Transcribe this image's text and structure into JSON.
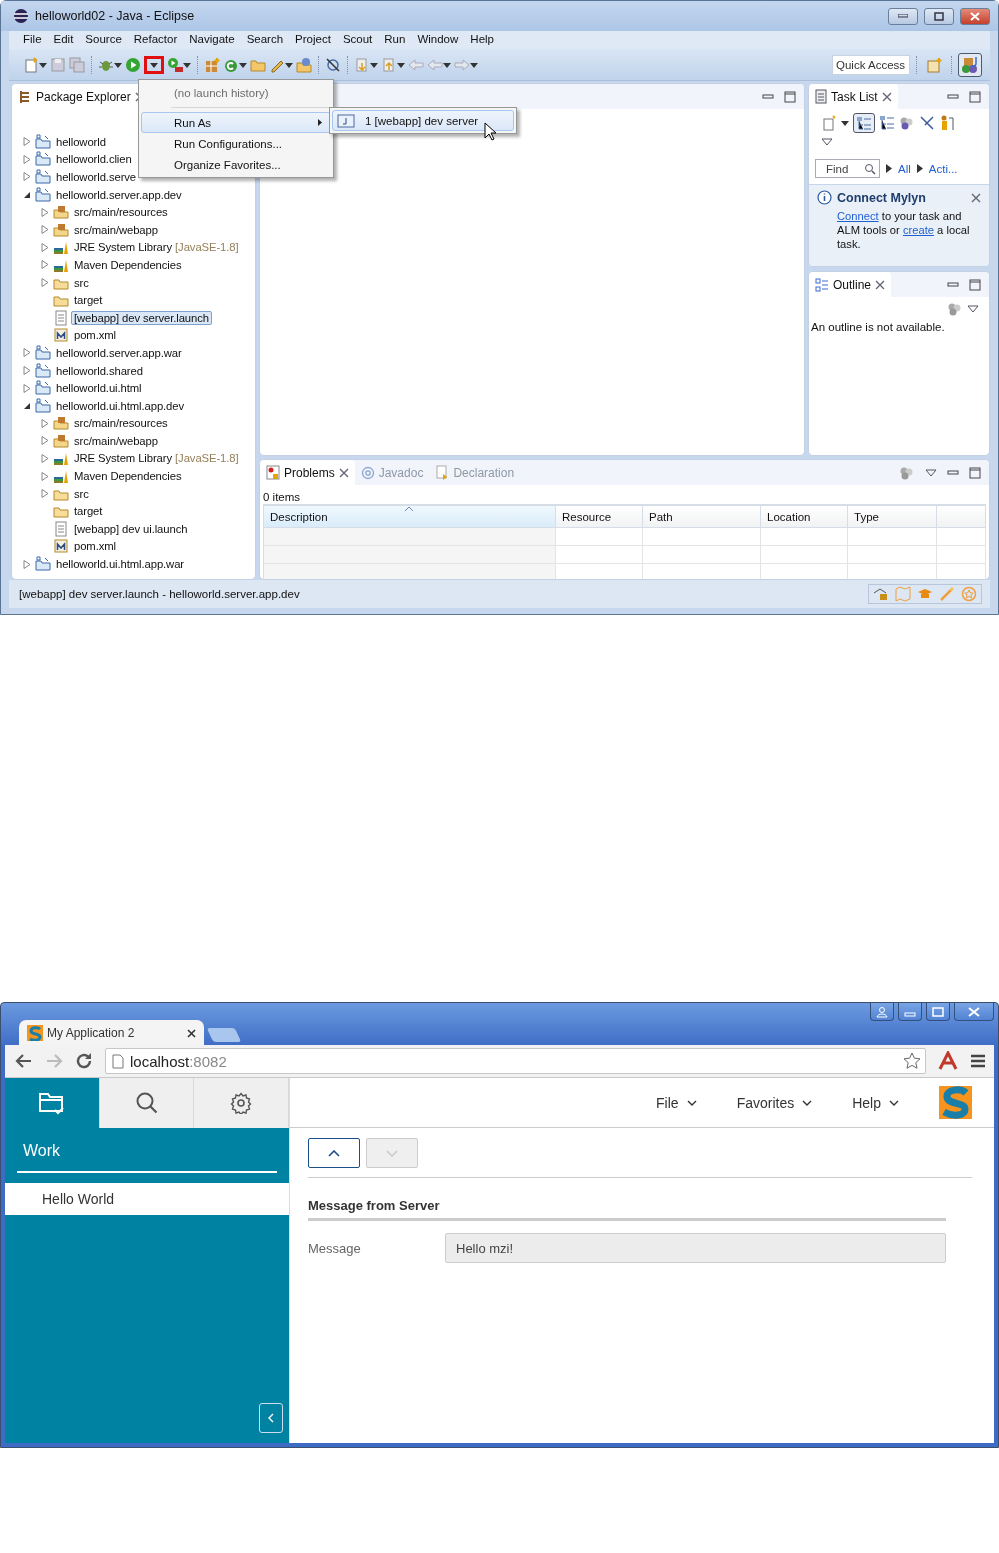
{
  "eclipse": {
    "window": {
      "title": "helloworld02 - Java - Eclipse"
    },
    "menu_bar": [
      "File",
      "Edit",
      "Source",
      "Refactor",
      "Navigate",
      "Search",
      "Project",
      "Scout",
      "Run",
      "Window",
      "Help"
    ],
    "toolbar": {
      "run_dropdown_highlighted": true,
      "quick_access": {
        "placeholder": "Quick Access"
      },
      "java_perspective_selected": true
    },
    "run_menu": {
      "items": [
        {
          "kind": "item",
          "label": "(no launch history)",
          "disabled": true,
          "selected": false,
          "submenu": false
        },
        {
          "kind": "separator"
        },
        {
          "kind": "item",
          "label": "Run As",
          "disabled": false,
          "selected": true,
          "submenu": true
        },
        {
          "kind": "item",
          "label": "Run Configurations...",
          "disabled": false,
          "selected": false,
          "submenu": false
        },
        {
          "kind": "item",
          "label": "Organize Favorites...",
          "disabled": false,
          "selected": false,
          "submenu": false
        }
      ]
    },
    "run_as_submenu": {
      "items": [
        {
          "label": "1 [webapp] dev server",
          "selected": true
        }
      ]
    },
    "package_explorer": {
      "tab": "Package Explorer",
      "tree": [
        {
          "label": "helloworld",
          "kind": "project",
          "expanded": false,
          "selected": false
        },
        {
          "label": "helloworld.clien",
          "kind": "project",
          "expanded": false,
          "selected": false
        },
        {
          "label": "helloworld.serve",
          "kind": "project",
          "expanded": false,
          "selected": false
        },
        {
          "label": "helloworld.server.app.dev",
          "kind": "project",
          "expanded": true,
          "selected": false,
          "children": [
            {
              "label": "src/main/resources",
              "kind": "source-folder",
              "expanded": false,
              "selected": false
            },
            {
              "label": "src/main/webapp",
              "kind": "source-folder",
              "expanded": false,
              "selected": false
            },
            {
              "label": "JRE System Library",
              "decoration": "[JavaSE-1.8]",
              "kind": "library",
              "expanded": false,
              "selected": false
            },
            {
              "label": "Maven Dependencies",
              "kind": "library",
              "expanded": false,
              "selected": false
            },
            {
              "label": "src",
              "kind": "folder",
              "expanded": false,
              "selected": false
            },
            {
              "label": "target",
              "kind": "folder",
              "selected": false
            },
            {
              "label": "[webapp] dev server.launch",
              "kind": "file",
              "selected": true
            },
            {
              "label": "pom.xml",
              "kind": "maven-file",
              "selected": false
            }
          ]
        },
        {
          "label": "helloworld.server.app.war",
          "kind": "project",
          "expanded": false,
          "selected": false
        },
        {
          "label": "helloworld.shared",
          "kind": "project",
          "expanded": false,
          "selected": false
        },
        {
          "label": "helloworld.ui.html",
          "kind": "project",
          "expanded": false,
          "selected": false
        },
        {
          "label": "helloworld.ui.html.app.dev",
          "kind": "project",
          "expanded": true,
          "selected": false,
          "children": [
            {
              "label": "src/main/resources",
              "kind": "source-folder",
              "expanded": false,
              "selected": false
            },
            {
              "label": "src/main/webapp",
              "kind": "source-folder",
              "expanded": false,
              "selected": false
            },
            {
              "label": "JRE System Library",
              "decoration": "[JavaSE-1.8]",
              "kind": "library",
              "expanded": false,
              "selected": false
            },
            {
              "label": "Maven Dependencies",
              "kind": "library",
              "expanded": false,
              "selected": false
            },
            {
              "label": "src",
              "kind": "folder",
              "expanded": false,
              "selected": false
            },
            {
              "label": "target",
              "kind": "folder",
              "selected": false
            },
            {
              "label": "[webapp] dev ui.launch",
              "kind": "file",
              "selected": false
            },
            {
              "label": "pom.xml",
              "kind": "maven-file",
              "selected": false
            }
          ]
        },
        {
          "label": "helloworld.ui.html.app.war",
          "kind": "project",
          "expanded": false,
          "selected": false
        }
      ]
    },
    "task_list": {
      "tab": "Task List",
      "categorized_pressed": true,
      "find": {
        "placeholder": "Find"
      },
      "filters": [
        "All",
        "Acti..."
      ],
      "mylyn": {
        "title": "Connect Mylyn",
        "message": [
          {
            "kind": "link",
            "text": "Connect"
          },
          {
            "kind": "text",
            "text": " to your task and ALM tools or "
          },
          {
            "kind": "link",
            "text": "create"
          },
          {
            "kind": "text",
            "text": " a local task."
          }
        ]
      }
    },
    "outline": {
      "tab": "Outline",
      "message": "An outline is not available."
    },
    "problems": {
      "tabs": [
        {
          "label": "Problems",
          "selected": true
        },
        {
          "label": "Javadoc",
          "selected": false
        },
        {
          "label": "Declaration",
          "selected": false
        }
      ],
      "summary": "0 items",
      "columns": [
        {
          "label": "Description",
          "sorted": true
        },
        {
          "label": "Resource",
          "sorted": false
        },
        {
          "label": "Path",
          "sorted": false
        },
        {
          "label": "Location",
          "sorted": false
        },
        {
          "label": "Type",
          "sorted": false
        }
      ]
    },
    "status_bar": {
      "text": "[webapp] dev server.launch - helloworld.server.app.dev"
    }
  },
  "browser": {
    "tabs": [
      {
        "title": "My Application 2",
        "selected": true
      }
    ],
    "address": {
      "host": "localhost",
      "port": ":8082"
    },
    "app": {
      "views": [
        {
          "kind": "outline",
          "selected": true
        },
        {
          "kind": "search",
          "selected": false
        },
        {
          "kind": "settings",
          "selected": false
        }
      ],
      "outline_title": "Work",
      "pages": [
        {
          "label": "Hello World",
          "selected": true
        }
      ],
      "menus": [
        "File",
        "Favorites",
        "Help"
      ],
      "navigation": [
        {
          "kind": "up",
          "disabled": false
        },
        {
          "kind": "down",
          "disabled": true
        }
      ],
      "group": {
        "title": "Message from Server",
        "fields": [
          {
            "label": "Message",
            "value": "Hello mzi!",
            "disabled": true
          }
        ]
      }
    }
  }
}
